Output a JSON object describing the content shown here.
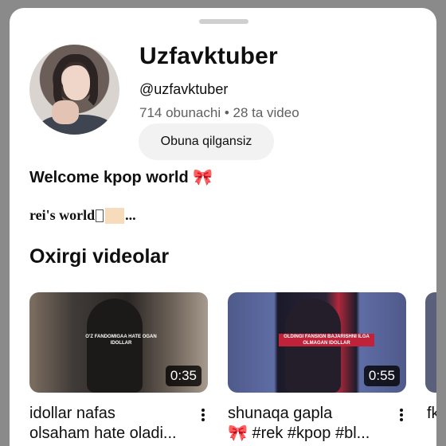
{
  "channel": {
    "name": "Uzfavktuber",
    "handle": "@uzfavktuber",
    "stats": "714 obunachi • 28 ta video",
    "subscribe_label": "Obuna qilgansiz",
    "description_line1": "Welcome kpop world ",
    "description_bow": "🎀",
    "description_line2_prefix": "rei's world",
    "description_line2_suffix": "..."
  },
  "section_title": "Oxirgi videolar",
  "videos": [
    {
      "duration": "0:35",
      "title_line1": "idollar nafas",
      "title_line2": "olsaham hate oladi...",
      "overlay_text": "O'Z FANDOMIGAA HATE OGAN IDOLLAR"
    },
    {
      "duration": "0:55",
      "title_line1": "shunaqa gapla",
      "title_line2_bow": "🎀",
      "title_line2": " #rek #kpop #bl...",
      "overlay_text": "OLDINGI FANSIGN BAJARISHNI ILGA OLMAGAN IDOLLAR"
    },
    {
      "title_line1": "fk"
    }
  ],
  "colors": {
    "backdrop": "#8a8a8a",
    "sheet": "#ffffff",
    "text_primary": "#0f0f0f",
    "text_secondary": "#606060",
    "button_bg": "#f2f2f2"
  },
  "icons": [
    "more-vert-icon"
  ]
}
